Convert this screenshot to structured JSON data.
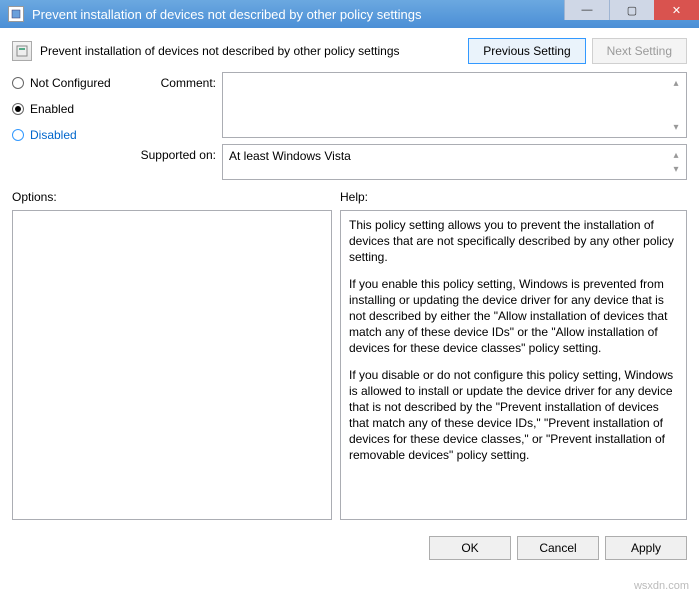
{
  "window": {
    "title": "Prevent installation of devices not described by other policy settings"
  },
  "header": {
    "policy_title": "Prevent installation of devices not described by other policy settings",
    "previous_label": "Previous Setting",
    "next_label": "Next Setting"
  },
  "radios": {
    "not_configured": "Not Configured",
    "enabled": "Enabled",
    "disabled": "Disabled",
    "selected": "enabled"
  },
  "fields": {
    "comment_label": "Comment:",
    "comment_value": "",
    "supported_label": "Supported on:",
    "supported_value": "At least Windows Vista"
  },
  "sections": {
    "options_label": "Options:",
    "help_label": "Help:"
  },
  "help": {
    "p1": "This policy setting allows you to prevent the installation of devices that are not specifically described by any other policy setting.",
    "p2": "If you enable this policy setting, Windows is prevented from installing or updating the device driver for any device that is not described by either the \"Allow installation of devices that match any of these device IDs\" or the \"Allow installation of devices for these device classes\" policy setting.",
    "p3": "If you disable or do not configure this policy setting, Windows is allowed to install or update the device driver for any device that is not described by the \"Prevent installation of devices that match any of these device IDs,\" \"Prevent installation of devices for these device classes,\" or \"Prevent installation of removable devices\" policy setting."
  },
  "footer": {
    "ok": "OK",
    "cancel": "Cancel",
    "apply": "Apply"
  },
  "watermark": "wsxdn.com"
}
